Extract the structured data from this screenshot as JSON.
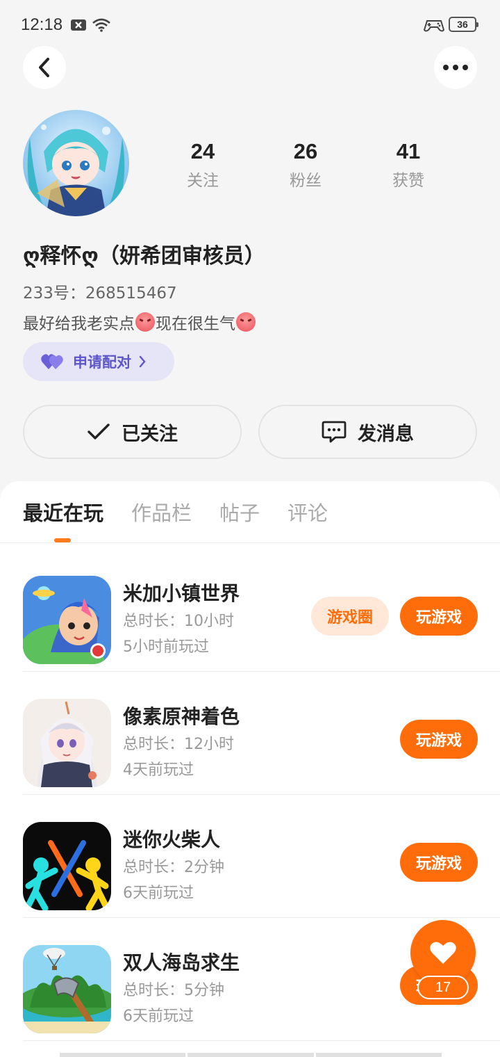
{
  "status_bar": {
    "time": "12:18",
    "battery": "36"
  },
  "profile": {
    "following_count": "24",
    "following_label": "关注",
    "followers_count": "26",
    "followers_label": "粉丝",
    "likes_count": "41",
    "likes_label": "获赞",
    "name": "ღ释怀ღ（妍希团审核员）",
    "uid": "233号：268515467",
    "bio_part1": "最好给我老实点",
    "bio_part2": "现在很生气",
    "pair_label": "申请配对",
    "follow_label": "已关注",
    "message_label": "发消息"
  },
  "tabs": [
    {
      "label": "最近在玩"
    },
    {
      "label": "作品栏"
    },
    {
      "label": "帖子"
    },
    {
      "label": "评论"
    }
  ],
  "games": [
    {
      "name": "米加小镇世界",
      "duration": "总时长：10小时",
      "last_played": "5小时前玩过",
      "circle_label": "游戏圈",
      "play_label": "玩游戏"
    },
    {
      "name": "像素原神着色",
      "duration": "总时长：12小时",
      "last_played": "4天前玩过",
      "play_label": "玩游戏"
    },
    {
      "name": "迷你火柴人",
      "duration": "总时长：2分钟",
      "last_played": "6天前玩过",
      "play_label": "玩游戏"
    },
    {
      "name": "双人海岛求生",
      "duration": "总时长：5分钟",
      "last_played": "6天前玩过",
      "play_label": "玩游戏"
    }
  ],
  "like_fab": {
    "count": "17"
  },
  "colors": {
    "accent": "#ff6d0a",
    "pair": "#5d55c9"
  }
}
